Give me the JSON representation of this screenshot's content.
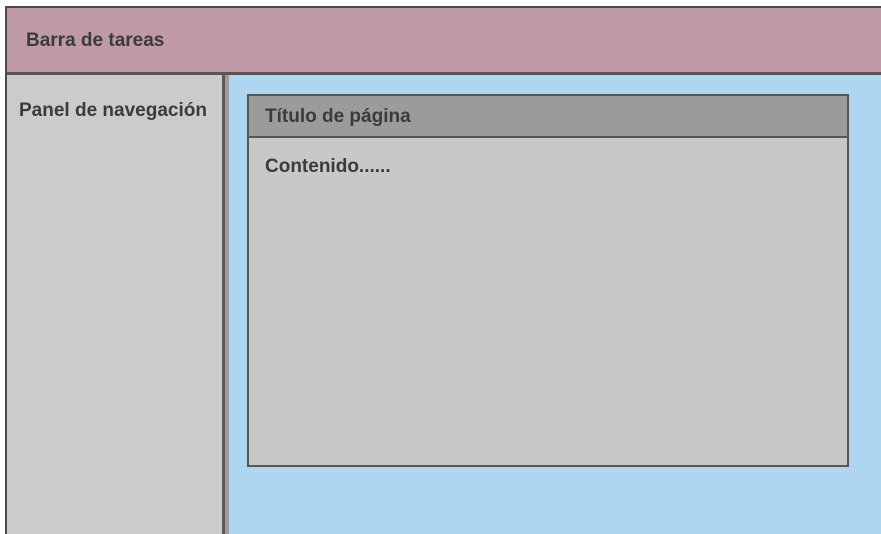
{
  "taskbar": {
    "label": "Barra de tareas"
  },
  "navigation": {
    "label": "Panel de navegación"
  },
  "page": {
    "title": "Título de página",
    "content": "Contenido......"
  },
  "colors": {
    "taskbar": "#bf99a8",
    "navigation": "#cbcbcb",
    "workspace": "#aed6f0",
    "page_body": "#c8c8c8",
    "page_title_bar": "#9b9b9b",
    "border": "#555555"
  }
}
